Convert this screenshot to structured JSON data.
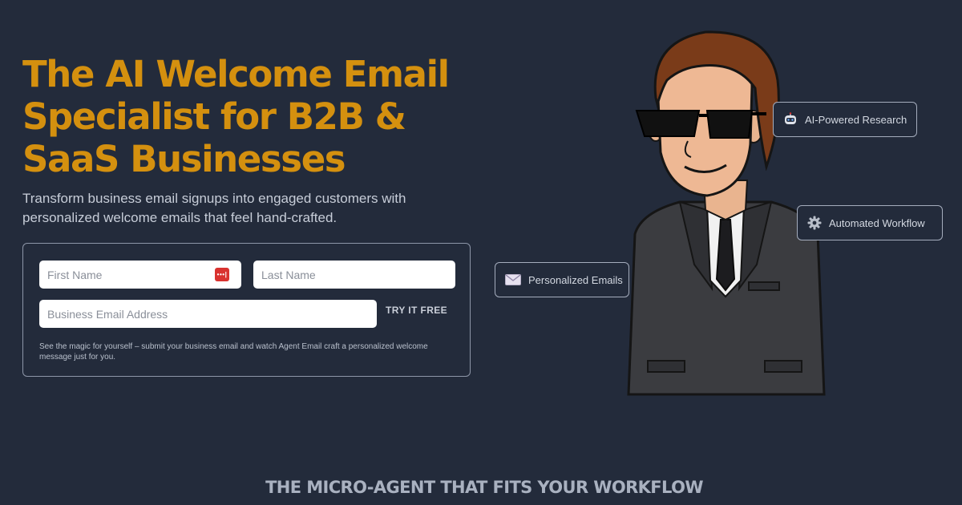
{
  "hero": {
    "headline": "The AI Welcome Email Specialist for B2B & SaaS Businesses",
    "subtitle": "Transform business email signups into engaged customers with personalized welcome emails that feel hand-crafted."
  },
  "form": {
    "first_name_placeholder": "First Name",
    "last_name_placeholder": "Last Name",
    "email_placeholder": "Business Email Address",
    "submit_label": "TRY IT FREE",
    "note": "See the magic for yourself – submit your business email and watch Agent Email craft a personalized welcome message just for you.",
    "password_manager_icon": "password-manager-icon"
  },
  "features": [
    {
      "label": "AI-Powered Research",
      "icon": "robot-icon"
    },
    {
      "label": "Automated Workflow",
      "icon": "gear-icon"
    },
    {
      "label": "Personalized Emails",
      "icon": "envelope-icon"
    }
  ],
  "section": {
    "title": "THE MICRO-AGENT THAT FITS YOUR WORKFLOW"
  },
  "colors": {
    "background": "#232b3b",
    "accent": "#d4900f",
    "border": "#8d96a8"
  }
}
